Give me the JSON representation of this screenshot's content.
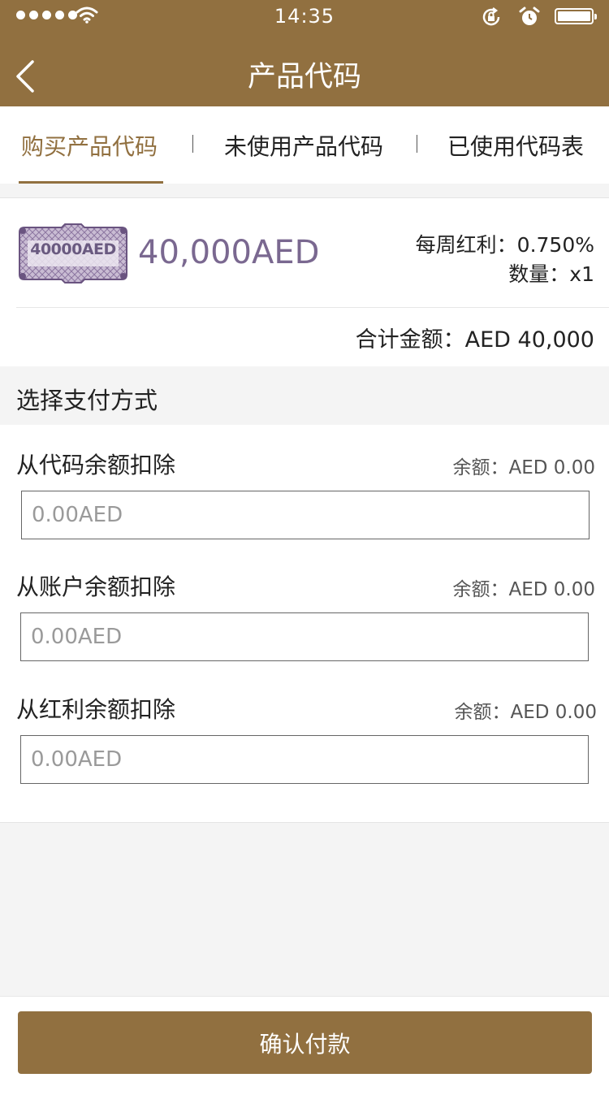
{
  "status_bar": {
    "time": "14:35"
  },
  "nav": {
    "title": "产品代码"
  },
  "tabs": [
    {
      "label": "购买产品代码"
    },
    {
      "label": "未使用产品代码"
    },
    {
      "label": "已使用代码表"
    }
  ],
  "product": {
    "voucher_label": "40000AED",
    "amount": "40,000AED",
    "weekly_bonus": "每周红利：0.750%",
    "quantity": "数量：x1",
    "total": "合计金额：AED 40,000"
  },
  "payment": {
    "section_title": "选择支付方式",
    "methods": [
      {
        "label": "从代码余额扣除",
        "balance": "余额：AED 0.00",
        "placeholder": "0.00AED"
      },
      {
        "label": "从账户余额扣除",
        "balance": "余额：AED 0.00",
        "placeholder": "0.00AED"
      },
      {
        "label": "从红利余额扣除",
        "balance": "余额：AED 0.00",
        "placeholder": "0.00AED"
      }
    ]
  },
  "confirm_label": "确认付款",
  "colors": {
    "brand": "#917040",
    "voucher_text": "#7a6890"
  }
}
